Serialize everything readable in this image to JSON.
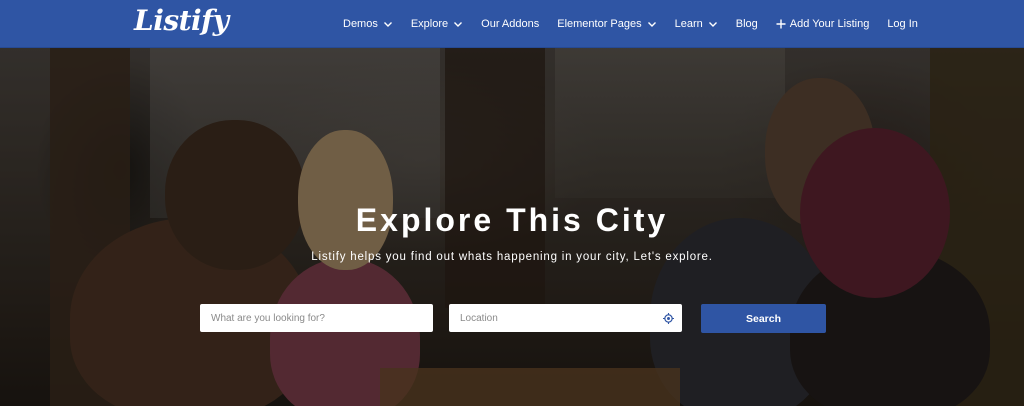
{
  "header": {
    "logo_text": "Listify",
    "brand_color": "#2f55a4",
    "nav": [
      {
        "label": "Demos",
        "icon": "chevron-down-icon"
      },
      {
        "label": "Explore",
        "icon": "chevron-down-icon"
      },
      {
        "label": "Our Addons",
        "icon": null
      },
      {
        "label": "Elementor Pages",
        "icon": "chevron-down-icon"
      },
      {
        "label": "Learn",
        "icon": "chevron-down-icon"
      },
      {
        "label": "Blog",
        "icon": null
      },
      {
        "label": "Add Your Listing",
        "icon": "plus-icon"
      },
      {
        "label": "Log In",
        "icon": null
      }
    ]
  },
  "hero": {
    "title": "Explore This City",
    "subtitle": "Listify helps you find out whats happening in your city, Let's explore.",
    "search": {
      "what_placeholder": "What are you looking for?",
      "what_value": "",
      "location_placeholder": "Location",
      "location_value": "",
      "location_icon": "crosshair-locate-icon",
      "button_label": "Search"
    }
  }
}
